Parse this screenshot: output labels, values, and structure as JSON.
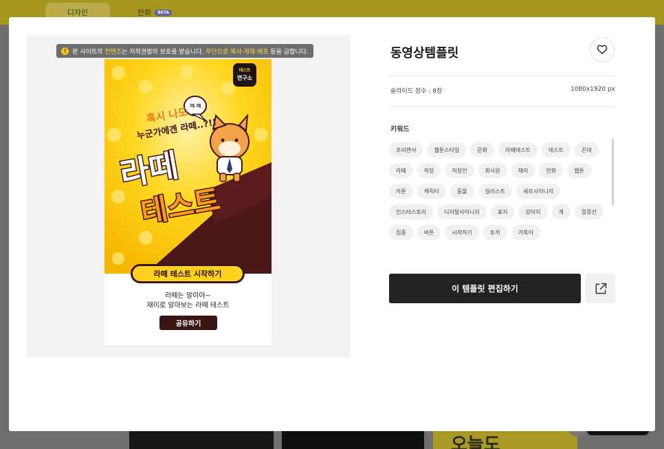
{
  "colors": {
    "accent_yellow": "#ffd21f",
    "poster_brown": "#3a1616",
    "button_dark": "#222222",
    "chip_bg": "#f1f1f1"
  },
  "background": {
    "tabs": [
      {
        "label": "디자인"
      },
      {
        "label": "만화",
        "badge": "BETA"
      }
    ],
    "peek_text": "오늘도"
  },
  "modal": {
    "notice": {
      "text_before": "본 사이트의 ",
      "highlight1": "컨텐츠",
      "text_mid": "는 저작권법의 보호를 받습니다. ",
      "highlight2": "무단으로 복사·게재·배포",
      "text_after": " 등을 금합니다."
    },
    "poster": {
      "logo_line1": "테스트",
      "logo_line2": "연구소",
      "bubble": "ㅋㅋ",
      "headline_small_1": "혹시 나도",
      "headline_small_2": "누군가에겐 라떼..?!!",
      "headline_big_1": "라떼",
      "headline_big_2": "테스트",
      "cta": "라떼 테스트 시작하기",
      "sub_1": "라떼는 말이야~",
      "sub_2": "재미로 알아보는 라떼 테스트",
      "share": "공유하기"
    },
    "title": "동영상템플릿",
    "favorite_icon": "heart-icon",
    "slide_count": "슬라이드 장수 : 8장",
    "dimensions": "1080x1920 px",
    "keyword_label": "키워드",
    "keywords": [
      "프리랜서",
      "웹툰스타일",
      "문화",
      "라떼테스트",
      "테스트",
      "꼰대",
      "라떼",
      "직장",
      "직장인",
      "회사원",
      "재미",
      "만화",
      "웹툰",
      "카툰",
      "캐릭터",
      "동물",
      "일러스트",
      "세로사이니지",
      "인스타스토리",
      "디지털사이니지",
      "표지",
      "강아지",
      "개",
      "말풍선",
      "집중",
      "버튼",
      "시작하기",
      "토끼",
      "거북이"
    ],
    "edit_button": "이 템플릿 편집하기",
    "open_icon": "external-link-icon"
  }
}
